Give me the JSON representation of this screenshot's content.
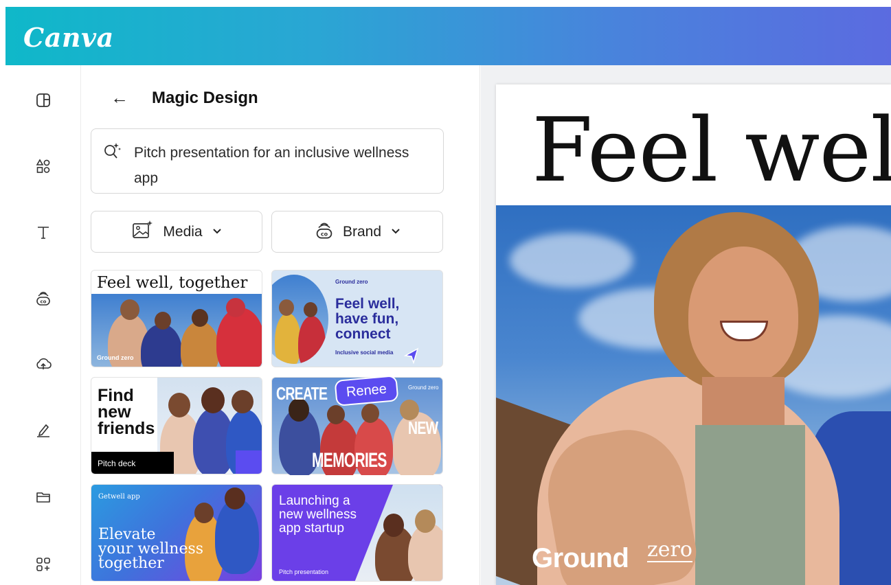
{
  "app": {
    "logo": "Canva"
  },
  "rail": {
    "items": [
      {
        "name": "rail-design-icon"
      },
      {
        "name": "rail-elements-icon"
      },
      {
        "name": "rail-text-icon"
      },
      {
        "name": "rail-brand-icon"
      },
      {
        "name": "rail-uploads-icon"
      },
      {
        "name": "rail-draw-icon"
      },
      {
        "name": "rail-projects-icon"
      },
      {
        "name": "rail-apps-icon"
      }
    ]
  },
  "panel": {
    "back_icon": "←",
    "title": "Magic Design",
    "prompt_text": "Pitch presentation for an inclusive wellness app",
    "filters": {
      "media": "Media",
      "brand": "Brand",
      "chevron": "⌄"
    }
  },
  "cards": {
    "c1": {
      "title": "Feel well, together",
      "brand": "Ground zero"
    },
    "c2": {
      "brand": "Ground zero",
      "headline_1": "Feel well,",
      "headline_2": "have fun,",
      "headline_3": "connect",
      "sub": "Inclusive social media"
    },
    "c3": {
      "line_1": "Find",
      "line_2": "new",
      "line_3": "friends",
      "badge": "Pitch deck"
    },
    "c4": {
      "top": "CREATE",
      "right": "NEW",
      "bottom": "MEMORIES",
      "brand": "Ground zero",
      "cursor_name": "Renee"
    },
    "c5": {
      "brand": "Getwell app",
      "line_1": "Elevate",
      "line_2": "your wellness",
      "line_3": "together"
    },
    "c6": {
      "line_1": "Launching a",
      "line_2": "new wellness",
      "line_3": "app startup",
      "sub": "Pitch presentation"
    }
  },
  "slide": {
    "title": "Feel wel",
    "brand": "Ground",
    "brand_sup": "zero"
  },
  "colors": {
    "accent": "#5b4cf0",
    "teal": "#0fb8c9",
    "blue": "#5b6be0",
    "navy": "#2a2d9c"
  }
}
